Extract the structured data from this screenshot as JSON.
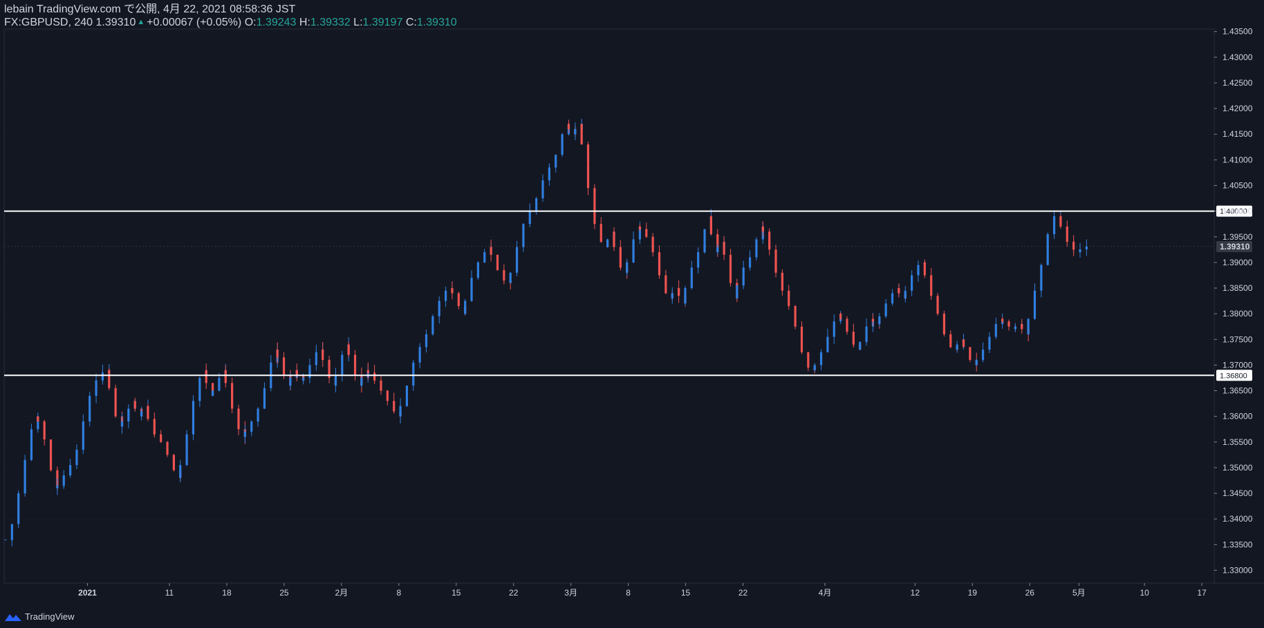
{
  "header": {
    "line1": "lebain TradingView.com で公開, 4月 22, 2021 08:58:36 JST",
    "symbol": "FX:GBPUSD, 240",
    "last": "1.39310",
    "change": "+0.00067 (+0.05%)",
    "o_label": "O:",
    "o_value": "1.39243",
    "h_label": "H:",
    "h_value": "1.39332",
    "l_label": "L:",
    "l_value": "1.39197",
    "c_label": "C:",
    "c_value": "1.39310"
  },
  "footer": {
    "brand": "TradingView"
  },
  "colors": {
    "background": "#131722",
    "up": "#2f7fe0",
    "down": "#ef5350",
    "text": "#d1d4dc",
    "teal": "#26a69a",
    "grid": "#2a2e39",
    "level_line": "#ffffff"
  },
  "chart_data": {
    "type": "candlestick",
    "symbol": "FX:GBPUSD",
    "interval": "240",
    "ylim": [
      1.3275,
      1.4355
    ],
    "y_ticks": [
      "1.33000",
      "1.33500",
      "1.34000",
      "1.34500",
      "1.35000",
      "1.35500",
      "1.36000",
      "1.36500",
      "1.37000",
      "1.37500",
      "1.38000",
      "1.38500",
      "1.39000",
      "1.39500",
      "1.40000",
      "1.40500",
      "1.41000",
      "1.41500",
      "1.42000",
      "1.42500",
      "1.43000",
      "1.43500"
    ],
    "x_ticks": [
      "2021",
      "11",
      "18",
      "25",
      "2月",
      "8",
      "15",
      "22",
      "3月",
      "8",
      "15",
      "22",
      "4月",
      "12",
      "19",
      "26",
      "5月",
      "10",
      "17"
    ],
    "horizontal_levels": [
      {
        "value": 1.4,
        "label": "1.40000"
      },
      {
        "value": 1.368,
        "label": "1.36800"
      }
    ],
    "last_price": {
      "value": 1.3931,
      "label": "1.39310"
    },
    "close_path": {
      "note_units": "x = calendar day index from 2020-12-22, y = price",
      "points": [
        [
          0,
          1.336
        ],
        [
          0.5,
          1.342
        ],
        [
          1,
          1.348
        ],
        [
          1.5,
          1.355
        ],
        [
          2,
          1.36
        ],
        [
          2.5,
          1.358
        ],
        [
          3,
          1.353
        ],
        [
          3.5,
          1.346
        ],
        [
          4,
          1.347
        ],
        [
          4.5,
          1.35
        ],
        [
          5,
          1.351
        ],
        [
          5.5,
          1.356
        ],
        [
          6,
          1.362
        ],
        [
          6.5,
          1.366
        ],
        [
          7,
          1.368
        ],
        [
          7.5,
          1.369
        ],
        [
          8,
          1.362
        ],
        [
          8.5,
          1.358
        ],
        [
          9,
          1.36
        ],
        [
          9.5,
          1.363
        ],
        [
          10,
          1.36
        ],
        [
          10.5,
          1.362
        ],
        [
          11,
          1.357
        ],
        [
          11.5,
          1.356
        ],
        [
          12,
          1.354
        ],
        [
          12.5,
          1.351
        ],
        [
          13,
          1.348
        ],
        [
          13.5,
          1.353
        ],
        [
          14,
          1.36
        ],
        [
          14.5,
          1.366
        ],
        [
          15,
          1.369
        ],
        [
          15.5,
          1.364
        ],
        [
          16,
          1.366
        ],
        [
          16.5,
          1.369
        ],
        [
          17,
          1.364
        ],
        [
          17.5,
          1.359
        ],
        [
          18,
          1.356
        ],
        [
          18.5,
          1.358
        ],
        [
          19,
          1.36
        ],
        [
          19.5,
          1.363
        ],
        [
          20,
          1.368
        ],
        [
          20.5,
          1.373
        ],
        [
          21,
          1.37
        ],
        [
          21.5,
          1.366
        ],
        [
          22,
          1.369
        ],
        [
          22.5,
          1.367
        ],
        [
          23,
          1.368
        ],
        [
          23.5,
          1.372
        ],
        [
          24,
          1.373
        ],
        [
          24.5,
          1.369
        ],
        [
          25,
          1.366
        ],
        [
          25.5,
          1.37
        ],
        [
          26,
          1.374
        ],
        [
          26.5,
          1.37
        ],
        [
          27,
          1.366
        ],
        [
          27.5,
          1.369
        ],
        [
          28,
          1.368
        ],
        [
          28.5,
          1.366
        ],
        [
          29,
          1.364
        ],
        [
          29.5,
          1.362
        ],
        [
          30,
          1.36
        ],
        [
          30.5,
          1.364
        ],
        [
          31,
          1.368
        ],
        [
          31.5,
          1.373
        ],
        [
          32,
          1.374
        ],
        [
          32.5,
          1.378
        ],
        [
          33,
          1.381
        ],
        [
          33.5,
          1.384
        ],
        [
          34,
          1.385
        ],
        [
          34.5,
          1.383
        ],
        [
          35,
          1.38
        ],
        [
          35.5,
          1.385
        ],
        [
          36,
          1.389
        ],
        [
          36.5,
          1.391
        ],
        [
          37,
          1.393
        ],
        [
          37.5,
          1.39
        ],
        [
          38,
          1.387
        ],
        [
          38.5,
          1.386
        ],
        [
          39,
          1.39
        ],
        [
          39.5,
          1.396
        ],
        [
          40,
          1.399
        ],
        [
          40.5,
          1.401
        ],
        [
          41,
          1.404
        ],
        [
          41.5,
          1.408
        ],
        [
          42,
          1.409
        ],
        [
          42.5,
          1.413
        ],
        [
          43,
          1.417
        ],
        [
          43.5,
          1.415
        ],
        [
          44,
          1.417
        ],
        [
          44.5,
          1.409
        ],
        [
          45,
          1.4
        ],
        [
          45.5,
          1.395
        ],
        [
          46,
          1.393
        ],
        [
          46.5,
          1.396
        ],
        [
          47,
          1.39
        ],
        [
          47.5,
          1.388
        ],
        [
          48,
          1.392
        ],
        [
          48.5,
          1.397
        ],
        [
          49,
          1.396
        ],
        [
          49.5,
          1.394
        ],
        [
          50,
          1.39
        ],
        [
          50.5,
          1.385
        ],
        [
          51,
          1.383
        ],
        [
          51.5,
          1.385
        ],
        [
          52,
          1.382
        ],
        [
          52.5,
          1.388
        ],
        [
          53,
          1.39
        ],
        [
          53.5,
          1.394
        ],
        [
          54,
          1.399
        ],
        [
          54.5,
          1.392
        ],
        [
          55,
          1.394
        ],
        [
          55.5,
          1.389
        ],
        [
          56,
          1.383
        ],
        [
          56.5,
          1.388
        ],
        [
          57,
          1.39
        ],
        [
          57.5,
          1.392
        ],
        [
          58,
          1.397
        ],
        [
          58.5,
          1.395
        ],
        [
          59,
          1.39
        ],
        [
          59.5,
          1.386
        ],
        [
          60,
          1.383
        ],
        [
          60.5,
          1.38
        ],
        [
          61,
          1.375
        ],
        [
          61.5,
          1.37
        ],
        [
          62,
          1.369
        ],
        [
          62.5,
          1.371
        ],
        [
          63,
          1.374
        ],
        [
          63.5,
          1.377
        ],
        [
          64,
          1.38
        ],
        [
          64.5,
          1.378
        ],
        [
          65,
          1.375
        ],
        [
          65.5,
          1.373
        ],
        [
          66,
          1.376
        ],
        [
          66.5,
          1.379
        ],
        [
          67,
          1.378
        ],
        [
          67.5,
          1.381
        ],
        [
          68,
          1.383
        ],
        [
          68.5,
          1.385
        ],
        [
          69,
          1.383
        ],
        [
          69.5,
          1.386
        ],
        [
          70,
          1.389
        ],
        [
          70.5,
          1.39
        ],
        [
          71,
          1.385
        ],
        [
          71.5,
          1.382
        ],
        [
          72,
          1.378
        ],
        [
          72.5,
          1.374
        ],
        [
          73,
          1.373
        ],
        [
          73.5,
          1.375
        ],
        [
          74,
          1.372
        ],
        [
          74.5,
          1.37
        ],
        [
          75,
          1.372
        ],
        [
          75.5,
          1.374
        ],
        [
          76,
          1.377
        ],
        [
          76.5,
          1.379
        ],
        [
          77,
          1.378
        ],
        [
          77.5,
          1.377
        ],
        [
          78,
          1.378
        ],
        [
          78.5,
          1.376
        ],
        [
          79,
          1.382
        ],
        [
          79.5,
          1.387
        ],
        [
          80,
          1.392
        ],
        [
          80.5,
          1.399
        ],
        [
          81,
          1.399
        ],
        [
          81.5,
          1.395
        ],
        [
          82,
          1.393
        ],
        [
          82.5,
          1.392
        ],
        [
          83,
          1.3931
        ]
      ]
    }
  }
}
